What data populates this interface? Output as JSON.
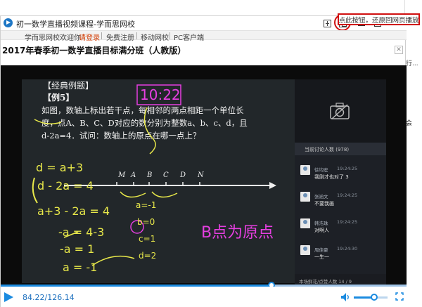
{
  "window": {
    "title": "初一数学直播视频课程-学而思网校"
  },
  "navbar": {
    "items": [
      "学而思网校欢迎你",
      "请登录",
      "免费注册",
      "移动网校",
      "PC客户端"
    ]
  },
  "tooltip": "点此按钮，还原回网页播放",
  "course": {
    "title": "2017年春季初一数学直播目标满分班（人教版）"
  },
  "background_page": {
    "snippets": [
      "行...",
      "会"
    ]
  },
  "video": {
    "board_lines": [
      "【经典例题】",
      "【例5】",
      "如图，数轴上标出若干点，每相邻的两点相距一个单位长",
      "度，点A、B、C、D对应的数分别为整数a、b、c、d，且",
      "d-2a=4．试问：数轴上的原点在哪一点上？"
    ],
    "axis_labels": [
      "M",
      "A",
      "B",
      "C",
      "D",
      "N"
    ],
    "handwriting": {
      "time": "10:22",
      "eq1": "d = a+3",
      "eq2": "d - 2a = 4",
      "eq3": "a+3 - 2a = 4",
      "eq4": "-a = 4-3",
      "eq5": "-a = 1",
      "eq6": "a = -1",
      "sol1": "a=-1",
      "sol2": "b=0",
      "sol3": "c=1",
      "sol4": "d=2",
      "answer": "B点为原点"
    }
  },
  "chat": {
    "header": "当前讨论人数 (978)",
    "messages": [
      {
        "name": "徐均宏",
        "time": "19:24:25",
        "text": "我刚才也对了 3"
      },
      {
        "name": "张涵文",
        "time": "19:24:25",
        "text": "不要我画"
      },
      {
        "name": "韩浩珠",
        "time": "19:24:25",
        "text": "对啊人"
      },
      {
        "name": "周佳豪",
        "time": "19:24:30",
        "text": "一生一"
      }
    ],
    "footer": "本场鲜花/点赞人数 14 / 9"
  },
  "player": {
    "time_readout": "84.22/126.14",
    "progress": 0.668,
    "volume": 0.6
  }
}
